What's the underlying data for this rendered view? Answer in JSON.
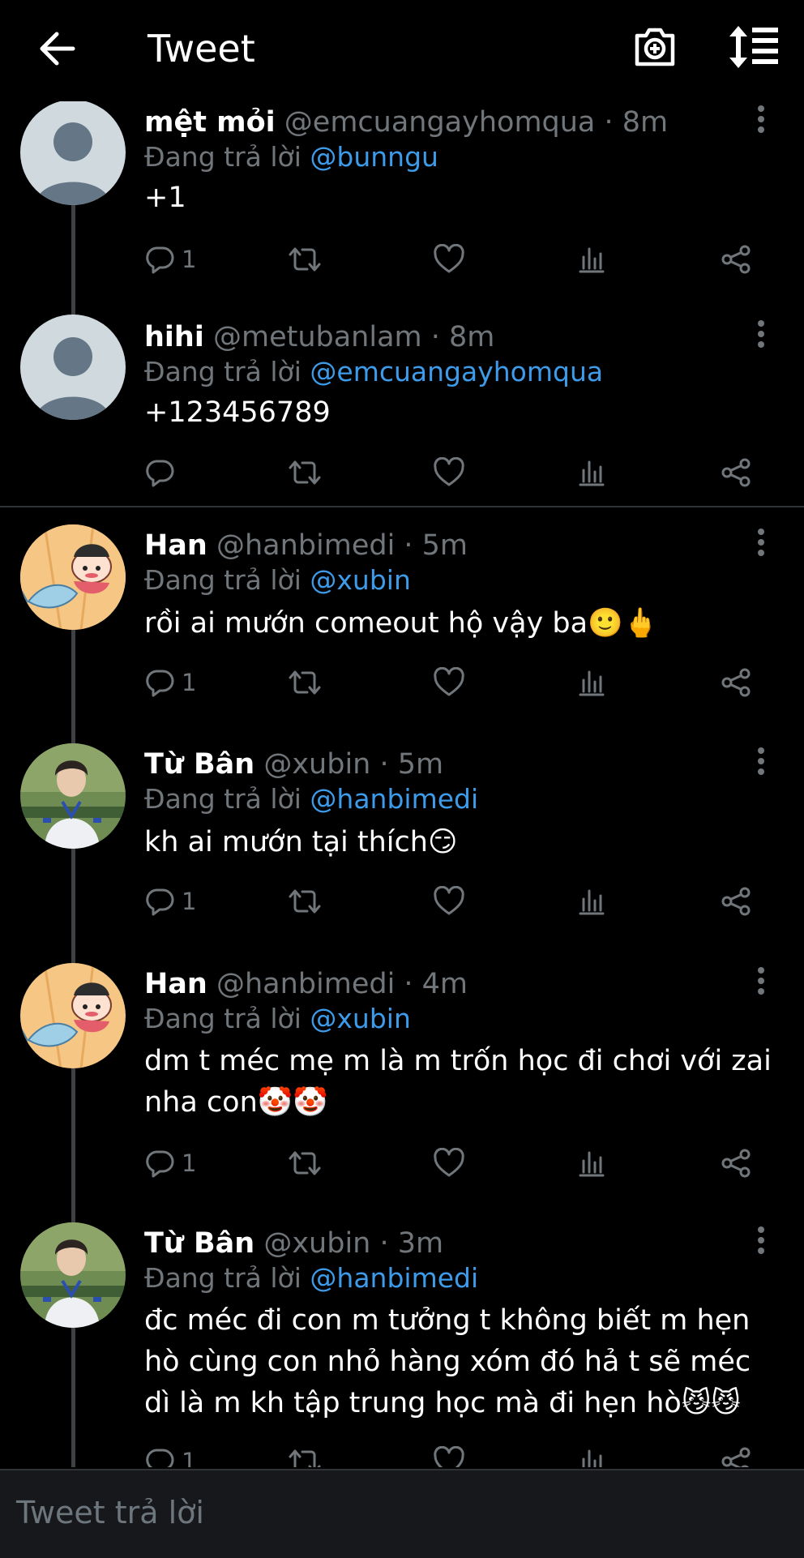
{
  "header": {
    "title": "Tweet"
  },
  "tweets": [
    {
      "name": "mệt mỏi",
      "meta": "@emcuangayhomqua · 8m",
      "reply_prefix": "Đang trả lời",
      "reply_to": "@bunngu",
      "body": "+1",
      "reply_count": "1"
    },
    {
      "name": "hihi",
      "meta": "@metubanlam · 8m",
      "reply_prefix": "Đang trả lời",
      "reply_to": "@emcuangayhomqua",
      "body": "+123456789",
      "reply_count": ""
    },
    {
      "name": "Han",
      "meta": "@hanbimedi · 5m",
      "reply_prefix": "Đang trả lời",
      "reply_to": "@xubin",
      "body": "rồi ai mướn comeout hộ vậy ba🙂🖕",
      "reply_count": "1"
    },
    {
      "name": "Từ Bân",
      "meta": "@xubin · 5m",
      "reply_prefix": "Đang trả lời",
      "reply_to": "@hanbimedi",
      "body": "kh ai mướn tại thích😏",
      "reply_count": "1"
    },
    {
      "name": "Han",
      "meta": "@hanbimedi · 4m",
      "reply_prefix": "Đang trả lời",
      "reply_to": "@xubin",
      "body": "dm t méc mẹ m là m trốn học đi chơi với zai nha con🤡🤡",
      "reply_count": "1"
    },
    {
      "name": "Từ Bân",
      "meta": "@xubin · 3m",
      "reply_prefix": "Đang trả lời",
      "reply_to": "@hanbimedi",
      "body": "đc méc đi con m tưởng t không biết m hẹn hò cùng con nhỏ hàng xóm đó hả t sẽ méc dì là m kh tập trung học mà đi hẹn hò😼😼",
      "reply_count": "1"
    }
  ],
  "compose": {
    "placeholder": "Tweet trả lời"
  },
  "colors": {
    "background": "#000000",
    "accent": "#3d9be9",
    "muted": "#71767b"
  }
}
